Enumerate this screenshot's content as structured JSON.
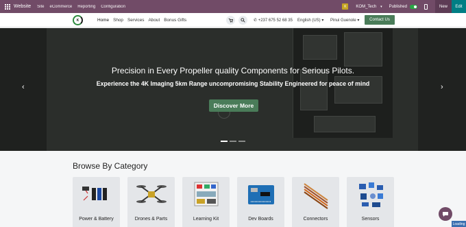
{
  "adminbar": {
    "app_name": "Website",
    "menus": [
      "Site",
      "eCommerce",
      "Reporting",
      "Configuration"
    ],
    "user_badge": "K",
    "company": "KOM_Tech",
    "published_label": "Published",
    "new_label": "New",
    "edit_label": "Edit",
    "color": "#714b67"
  },
  "header": {
    "nav": [
      "Home",
      "Shop",
      "Services",
      "About",
      "Bonus Gifts"
    ],
    "phone": "+237 675 52 68 35",
    "language": "English (US)",
    "user": "Pinui Guenole",
    "contact_label": "Contact Us",
    "accent": "#4a7c59"
  },
  "hero": {
    "title": "Precision in Every Propeller quality Components for Serious Pilots.",
    "subtitle": "Experience the 4K Imaging 5km Range uncompromising Stability Engineered for peace of mind",
    "cta_label": "Discover More",
    "prev_icon": "chevron-left-icon",
    "next_icon": "chevron-right-icon"
  },
  "categories": {
    "heading": "Browse By Category",
    "items": [
      {
        "label": "Power & Battery"
      },
      {
        "label": "Drones & Parts"
      },
      {
        "label": "Learning Kit"
      },
      {
        "label": "Dev Boards"
      },
      {
        "label": "Connectors"
      },
      {
        "label": "Sensors"
      }
    ]
  },
  "status": {
    "loading": "Loading"
  }
}
